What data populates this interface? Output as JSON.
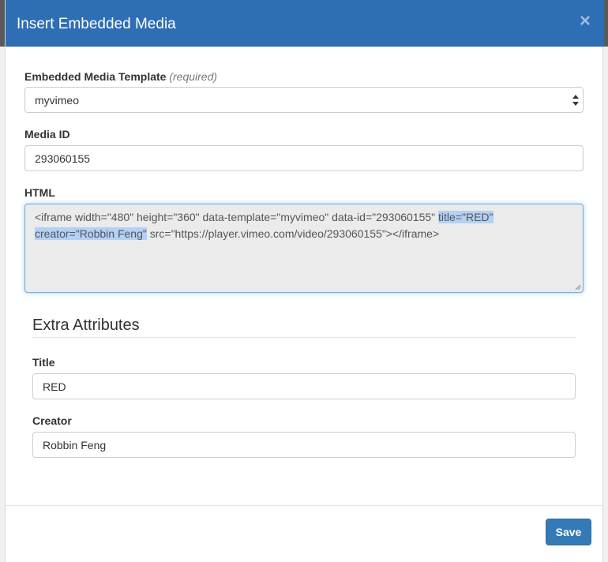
{
  "modal": {
    "title": "Insert Embedded Media",
    "close_label": "×"
  },
  "template_field": {
    "label": "Embedded Media Template",
    "hint": "(required)",
    "value": "myvimeo"
  },
  "media_id_field": {
    "label": "Media ID",
    "value": "293060155"
  },
  "html_field": {
    "label": "HTML",
    "text_before": "<iframe width=\"480\" height=\"360\" data-template=\"myvimeo\" data-id=\"293060155\" ",
    "text_selected_1": "title=\"RED\" ",
    "text_selected_2": "creator=\"Robbin Feng\"",
    "text_after": " src=\"https://player.vimeo.com/video/293060155\"></iframe>"
  },
  "extra_attributes": {
    "heading": "Extra Attributes",
    "title_label": "Title",
    "title_value": "RED",
    "creator_label": "Creator",
    "creator_value": "Robbin Feng"
  },
  "footer": {
    "save_label": "Save"
  },
  "colors": {
    "header_bg": "#2e6eb4",
    "primary_button": "#337ab7",
    "selection": "#b3d1f5"
  }
}
